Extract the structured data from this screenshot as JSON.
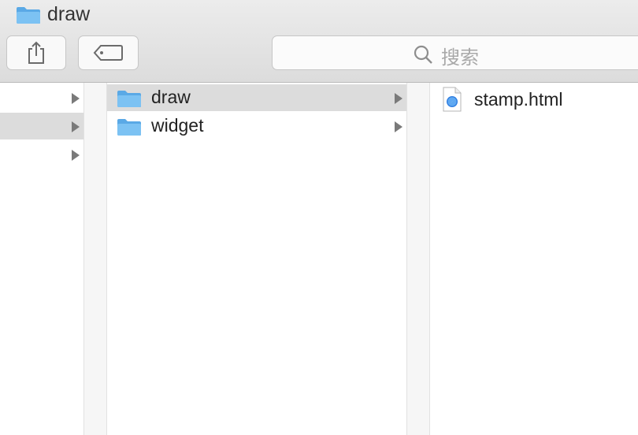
{
  "window": {
    "title": "draw"
  },
  "search": {
    "placeholder": "搜索"
  },
  "columns": {
    "parent": {
      "rows": [
        {
          "selected": false
        },
        {
          "selected": true
        },
        {
          "selected": false
        }
      ]
    },
    "current": {
      "items": [
        {
          "label": "draw",
          "selected": true
        },
        {
          "label": "widget",
          "selected": false
        }
      ]
    },
    "files": {
      "items": [
        {
          "label": "stamp.html",
          "icon": "html-document-icon"
        }
      ]
    }
  },
  "colors": {
    "folder": "#7cc2f3",
    "selection": "#dcdcdc",
    "arrow": "#7a7a7a"
  }
}
